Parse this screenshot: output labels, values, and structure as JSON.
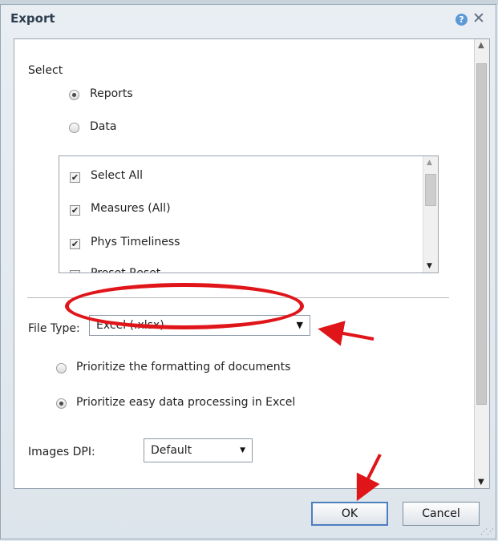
{
  "dialog": {
    "title": "Export",
    "help_glyph": "?",
    "close_glyph": "✕"
  },
  "select_section": {
    "heading": "Select",
    "radios": [
      {
        "label": "Reports",
        "checked": true
      },
      {
        "label": "Data",
        "checked": false
      }
    ],
    "list_items": [
      {
        "label": "Select All",
        "checked": true
      },
      {
        "label": "Measures (All)",
        "checked": true
      },
      {
        "label": "Phys Timeliness",
        "checked": true
      },
      {
        "label": "Preset Reset",
        "checked": true
      }
    ]
  },
  "file_type": {
    "label": "File Type:",
    "value": "Excel (.xlsx)",
    "options_radios": [
      {
        "label": "Prioritize the formatting of documents",
        "checked": false
      },
      {
        "label": "Prioritize easy data processing in Excel",
        "checked": true
      }
    ]
  },
  "images_dpi": {
    "label": "Images DPI:",
    "value": "Default"
  },
  "buttons": {
    "ok": "OK",
    "cancel": "Cancel"
  },
  "glyphs": {
    "check": "✔",
    "caret_down": "▼",
    "caret_up": "▲"
  },
  "icons": [
    "help-icon",
    "close-icon",
    "chevron-down-icon",
    "chevron-up-icon",
    "resize-grip-icon"
  ],
  "colors": {
    "annotation_red": "#e0151a",
    "ok_border": "#4d7fbf",
    "title_text": "#2e3f51"
  }
}
